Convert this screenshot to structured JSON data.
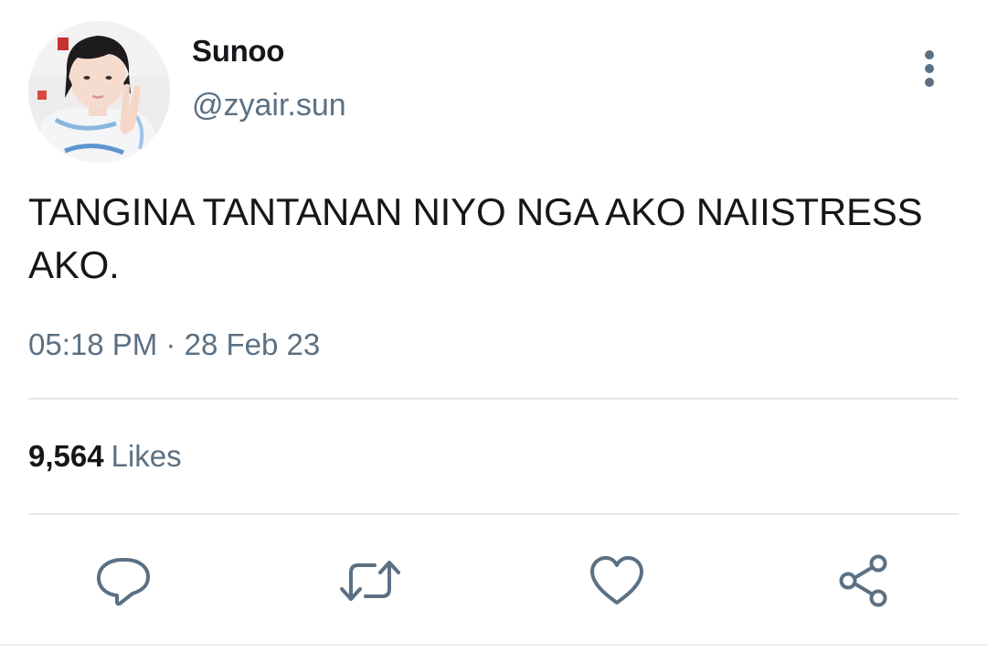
{
  "user": {
    "display_name": "Sunoo",
    "handle": "@zyair.sun",
    "avatar_icon": "profile-photo"
  },
  "tweet": {
    "text": "TANGINA TANTANAN NIYO NGA AKO NAIISTRESS AKO.",
    "time": "05:18 PM",
    "separator": "·",
    "date": "28 Feb 23"
  },
  "stats": {
    "likes_count": "9,564",
    "likes_label": "Likes"
  },
  "actions": {
    "reply_icon": "reply-icon",
    "retweet_icon": "retweet-icon",
    "like_icon": "heart-icon",
    "share_icon": "share-icon",
    "more_icon": "more-vertical-icon"
  },
  "colors": {
    "text_primary": "#14171a",
    "text_secondary": "#5b7083",
    "icon": "#5b7083",
    "divider": "#e6e9ec",
    "background": "#ffffff"
  }
}
